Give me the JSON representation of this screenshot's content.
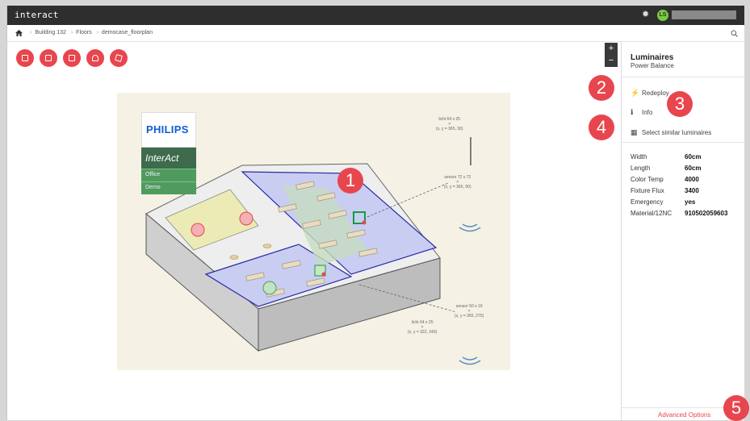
{
  "app": {
    "name": "interact"
  },
  "header": {
    "user_initials": "LS"
  },
  "breadcrumb": {
    "items": [
      "Building 132",
      "Floors",
      "democase_floorplan"
    ]
  },
  "zoom": {
    "in_label": "+",
    "out_label": "−"
  },
  "logo": {
    "brand": "PHILIPS",
    "product": "InterAct",
    "rows": [
      "Office",
      "Demo"
    ]
  },
  "floorplan_annotations": [
    {
      "label": "licht 64 x 25",
      "coords": "(x, y = 365, 30)"
    },
    {
      "label": "sensor 72 x 72",
      "coords": "(x, y = 365, 90)"
    },
    {
      "label": "sensor 50 x 19",
      "coords": "(x, y = 365, 275)"
    },
    {
      "label": "licht 64 x 25",
      "coords": "(x, y = 322, 240)"
    }
  ],
  "panel": {
    "title": "Luminaires",
    "subtitle": "Power Balance",
    "actions": [
      "Redeploy",
      "Info",
      "Select similar luminaires"
    ],
    "specs": [
      {
        "label": "Width",
        "value": "60cm"
      },
      {
        "label": "Length",
        "value": "60cm"
      },
      {
        "label": "Color Temp",
        "value": "4000"
      },
      {
        "label": "Fixture Flux",
        "value": "3400"
      },
      {
        "label": "Emergency",
        "value": "yes"
      },
      {
        "label": "Material/12NC",
        "value": "910502059603"
      }
    ],
    "advanced": "Advanced Options"
  },
  "callouts": [
    "1",
    "2",
    "3",
    "4",
    "5"
  ],
  "colors": {
    "accent": "#e8464f",
    "topbar": "#2e2e2e",
    "room_blue": "#c9cdf2",
    "room_yellow": "#ecebb5"
  }
}
